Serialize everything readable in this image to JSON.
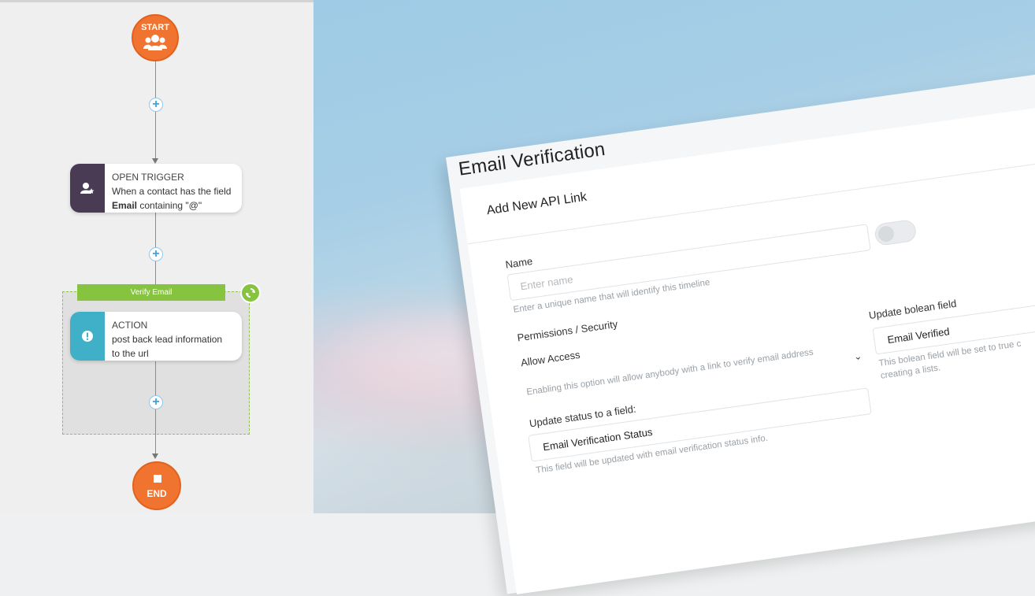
{
  "workflow": {
    "start_label": "START",
    "end_label": "END",
    "trigger": {
      "title": "OPEN TRIGGER",
      "line1": "When a contact has the field",
      "field": "Email",
      "line2_rest": " containing \"@\""
    },
    "group_label": "Verify Email",
    "action": {
      "title": "ACTION",
      "line1": "post back lead information",
      "line2": "to the url"
    },
    "colors": {
      "start_end": "#f07430",
      "trigger": "#4a3b55",
      "action": "#40b0c8",
      "group": "#86c33f",
      "plus": "#3aa4e3"
    }
  },
  "form": {
    "page_title": "Email Verification",
    "card_title": "Add New API Link",
    "name": {
      "label": "Name",
      "placeholder": "Enter name",
      "hint": "Enter a unique name that will identify this timeline"
    },
    "permissions_heading": "Permissions / Security",
    "allow_access": {
      "label": "Allow Access",
      "hint": "Enabling this option will allow anybody with a link to verify email address",
      "enabled": false
    },
    "status_field": {
      "label": "Update status to a field:",
      "value": "Email Verification Status",
      "hint": "This field will be updated with email verification status info."
    },
    "boolean_field": {
      "label": "Update bolean field",
      "value": "Email Verified",
      "hint1": "This bolean field will be set to true c",
      "hint2": "creating a lists."
    }
  }
}
